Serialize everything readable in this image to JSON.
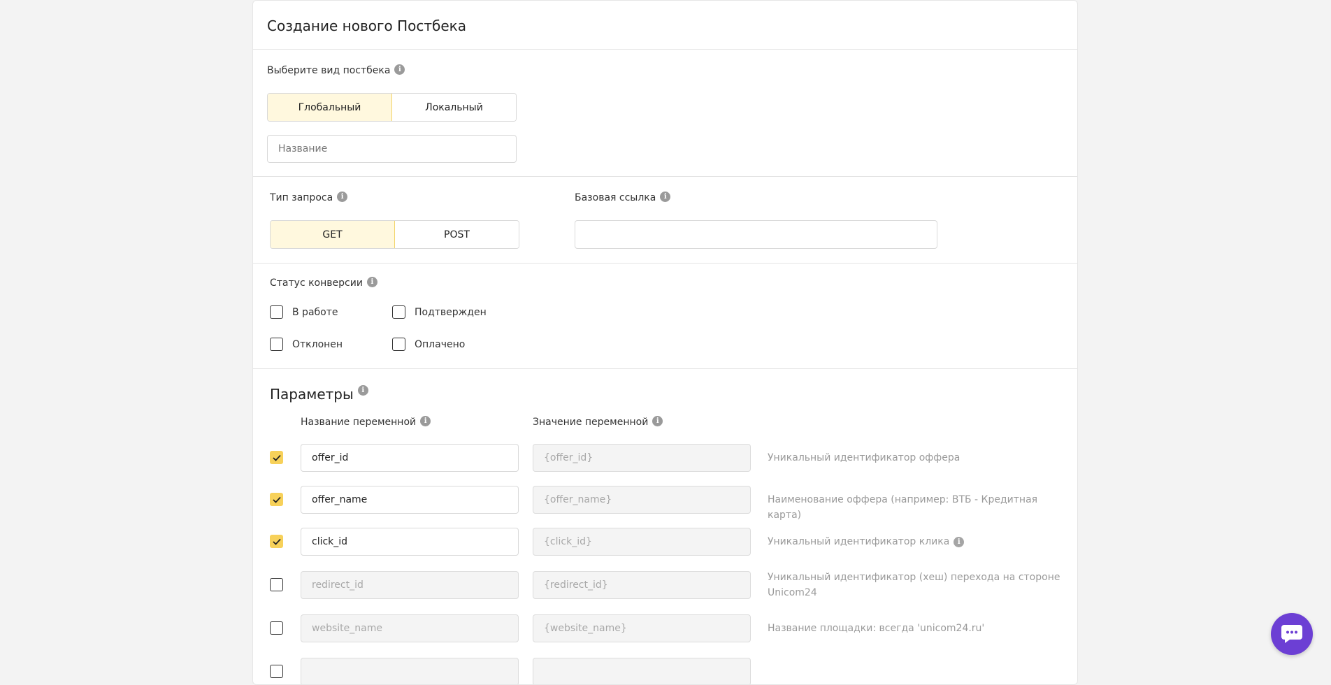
{
  "header": {
    "title": "Создание нового Постбека"
  },
  "postback_type": {
    "label": "Выберите вид постбека",
    "options": [
      {
        "label": "Глобальный",
        "active": true
      },
      {
        "label": "Локальный",
        "active": false
      }
    ]
  },
  "name_field": {
    "placeholder": "Название",
    "value": ""
  },
  "request_type": {
    "label": "Тип запроса",
    "options": [
      {
        "label": "GET",
        "active": true
      },
      {
        "label": "POST",
        "active": false
      }
    ]
  },
  "base_url": {
    "label": "Базовая ссылка",
    "value": ""
  },
  "conversion_status": {
    "label": "Статус конверсии",
    "options": [
      {
        "label": "В работе",
        "checked": false
      },
      {
        "label": "Подтвержден",
        "checked": false
      },
      {
        "label": "Отклонен",
        "checked": false
      },
      {
        "label": "Оплачено",
        "checked": false
      }
    ]
  },
  "params": {
    "title": "Параметры",
    "col_name": "Название переменной",
    "col_value": "Значение переменной",
    "rows": [
      {
        "checked": true,
        "name": "offer_id",
        "value": "{offer_id}",
        "desc": "Уникальный идентификатор оффера",
        "info": false
      },
      {
        "checked": true,
        "name": "offer_name",
        "value": "{offer_name}",
        "desc": "Наименование оффера (например: ВТБ - Кредитная карта)",
        "info": false
      },
      {
        "checked": true,
        "name": "click_id",
        "value": "{click_id}",
        "desc": "Уникальный идентификатор клика",
        "info": true
      },
      {
        "checked": false,
        "name": "redirect_id",
        "value": "{redirect_id}",
        "desc": "Уникальный идентификатор (хеш) перехода на стороне Unicom24",
        "info": false
      },
      {
        "checked": false,
        "name": "website_name",
        "value": "{website_name}",
        "desc": "Название площадки: всегда 'unicom24.ru'",
        "info": false
      },
      {
        "checked": false,
        "name": "",
        "value": "",
        "desc": "",
        "info": false
      }
    ]
  },
  "icons": {
    "info": "info-icon",
    "check": "checkmark-icon",
    "chat": "chat-icon"
  },
  "colors": {
    "accent": "#f7d15a",
    "active_bg": "#fff8de",
    "chat": "#6c3fd4"
  }
}
